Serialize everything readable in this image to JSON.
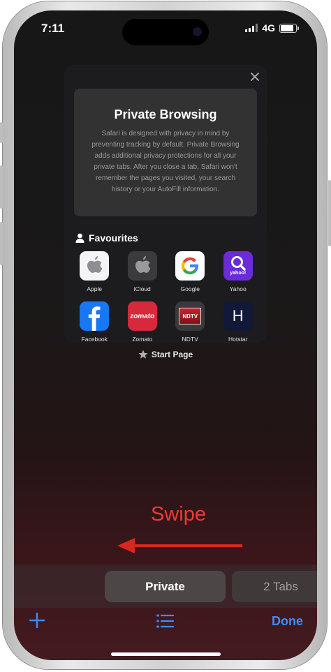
{
  "status_bar": {
    "time": "7:11",
    "network": "4G",
    "battery_level": 0.85
  },
  "tab_preview": {
    "private_browsing": {
      "title": "Private Browsing",
      "description": "Safari is designed with privacy in mind by preventing tracking by default. Private Browsing adds additional privacy protections for all your private tabs. After you close a tab, Safari won't remember the pages you visited, your search history or your AutoFill information."
    },
    "favourites": {
      "title": "Favourites",
      "items": [
        {
          "label": "Apple",
          "icon": "apple-logo-icon"
        },
        {
          "label": "iCloud",
          "icon": "icloud-apple-logo-icon"
        },
        {
          "label": "Google",
          "icon": "google-g-icon"
        },
        {
          "label": "Yahoo",
          "icon": "yahoo-search-icon",
          "icon_text": "yahoo!"
        },
        {
          "label": "Facebook",
          "icon": "facebook-f-icon"
        },
        {
          "label": "Zomato",
          "icon": "zomato-icon",
          "icon_text": "zomato"
        },
        {
          "label": "NDTV",
          "icon": "ndtv-icon",
          "icon_text": "NDTV"
        },
        {
          "label": "Hotstar",
          "icon": "hotstar-h-icon",
          "icon_text": "H"
        }
      ]
    }
  },
  "start_page_label": "Start Page",
  "annotation": {
    "text": "Swipe",
    "color": "#ee3a32"
  },
  "tab_groups": {
    "private_label": "Private",
    "tabs_label": "2 Tabs"
  },
  "toolbar": {
    "done_label": "Done"
  },
  "colors": {
    "accent": "#3d8bff",
    "annotation": "#ee3a32"
  }
}
